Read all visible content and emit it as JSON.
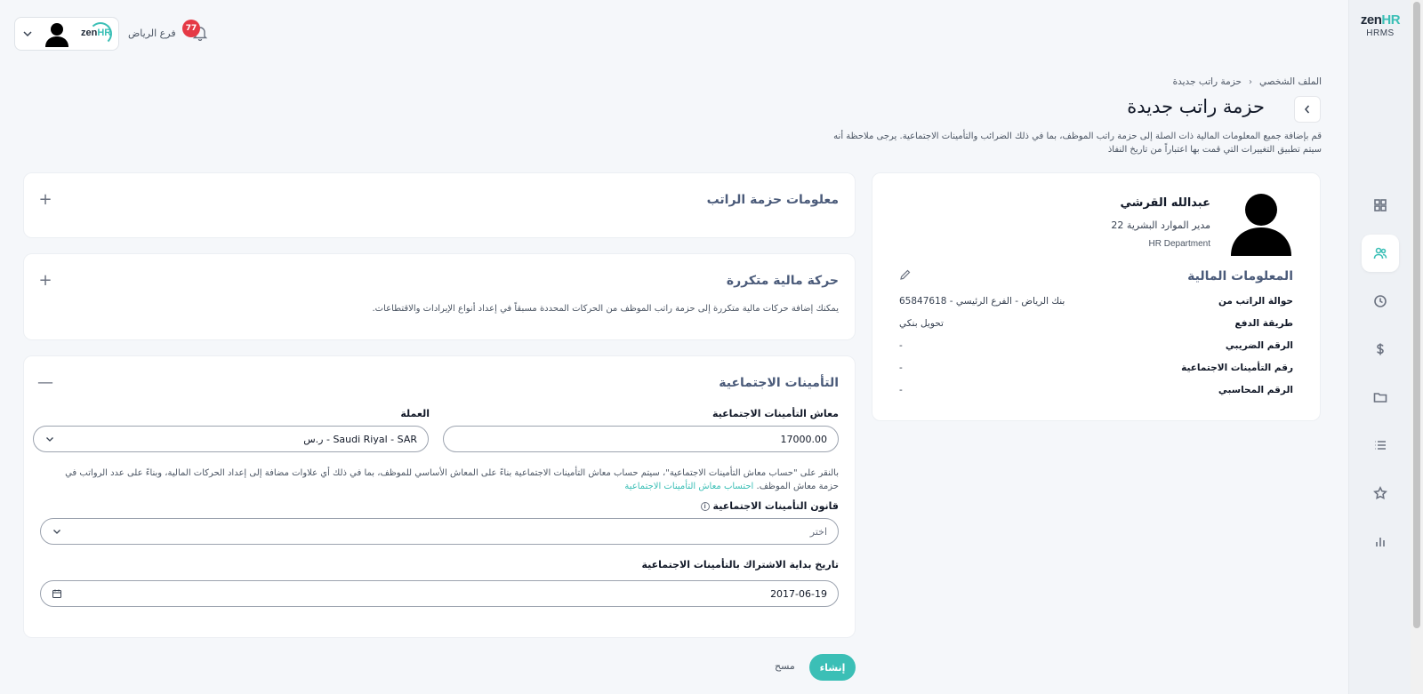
{
  "brand": {
    "name": "zen",
    "name_accent": "HR",
    "subtitle": "HRMS"
  },
  "rail": {
    "items": [
      {
        "name": "dashboard",
        "icon": "grid-icon"
      },
      {
        "name": "people",
        "icon": "users-icon",
        "active": true
      },
      {
        "name": "time",
        "icon": "clock-icon"
      },
      {
        "name": "payroll",
        "icon": "dollar-icon"
      },
      {
        "name": "documents",
        "icon": "folder-icon"
      },
      {
        "name": "lists",
        "icon": "list-icon"
      },
      {
        "name": "favorites",
        "icon": "star-icon"
      },
      {
        "name": "reports",
        "icon": "chart-icon"
      }
    ]
  },
  "topbar": {
    "branch": "فرع الرياض",
    "notifications_count": "77",
    "company_logo": "zenHR"
  },
  "breadcrumb": {
    "parent": "الملف الشخصي",
    "current": "حزمة راتب جديدة"
  },
  "page": {
    "title": "حزمة راتب جديدة",
    "description": "قم بإضافة جميع المعلومات المالية ذات الصلة إلى حزمة راتب الموظف، بما في ذلك الضرائب والتأمينات الاجتماعية. يرجى ملاحظة أنه سيتم تطبيق التغييرات التي قمت بها اعتباراً من تاريخ النفاذ"
  },
  "employee": {
    "name": "عبدالله القرشي",
    "role": "مدير الموارد البشرية 22",
    "department": "HR Department",
    "financial_title": "المعلومات المالية",
    "rows": [
      {
        "label": "حوالة الراتب من",
        "value": "بنك الرياض - الفرع الرئيسي - 65847618"
      },
      {
        "label": "طريقة الدفع",
        "value": "تحويل بنكي"
      },
      {
        "label": "الرقم الضريبي",
        "value": "-"
      },
      {
        "label": "رقم التأمينات الاجتماعية",
        "value": "-"
      },
      {
        "label": "الرقم المحاسبي",
        "value": "-"
      }
    ]
  },
  "sections": {
    "salary_info": {
      "title": "معلومات حزمة الراتب",
      "toggle": "+"
    },
    "recurring": {
      "title": "حركة مالية متكررة",
      "toggle": "+",
      "description": "يمكنك إضافة حركات مالية متكررة إلى حزمة راتب الموظف من الحركات المحددة مسبقاً في إعداد أنواع الإيرادات والاقتطاعات."
    },
    "social_security": {
      "title": "التأمينات الاجتماعية",
      "toggle": "—",
      "salary_label": "معاش التأمينات الاجتماعية",
      "salary_value": "17000.00",
      "currency_label": "العملة",
      "currency_value": "Saudi Riyal - SAR - ر.س",
      "description": "بالنقر على \"حساب معاش التأمينات الاجتماعية\"، سيتم حساب معاش التأمينات الاجتماعية بناءً على المعاش الأساسي للموظف، بما في ذلك أي علاوات مضافة إلى إعداد الحركات المالية، وبناءً على عدد الرواتب في حزمة معاش الموظف.",
      "calc_link": "احتساب معاش التأمينات الاجتماعية",
      "law_label": "قانون التأمينات الاجتماعية",
      "law_placeholder": "اختر",
      "start_label": "تاريخ بداية الاشتراك بالتأمينات الاجتماعية",
      "start_value": "2017-06-19"
    }
  },
  "actions": {
    "create": "إنشاء",
    "clear": "مسح"
  },
  "colors": {
    "accent": "#3bbfb6",
    "badge": "#e53945",
    "section_title": "#4b5b7a"
  }
}
